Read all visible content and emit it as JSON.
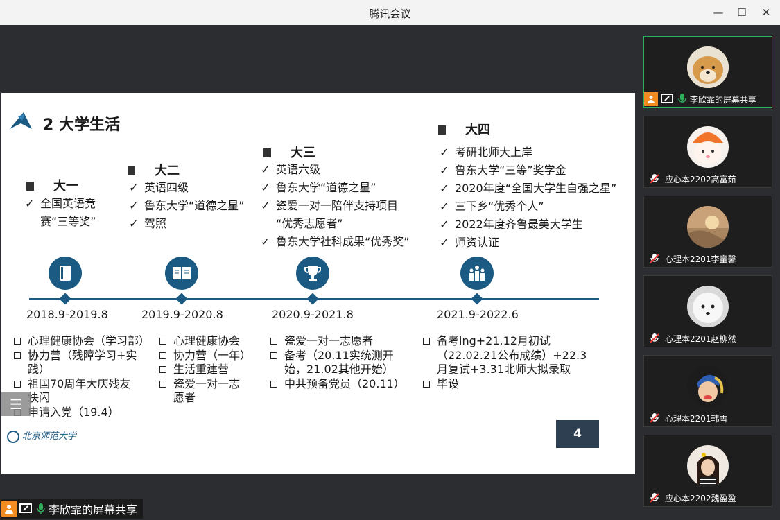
{
  "window": {
    "title": "腾讯会议",
    "minimize": "—",
    "maximize": "☐",
    "close": "✕"
  },
  "slide": {
    "title": "2 大学生活",
    "page_number": "4",
    "years": [
      {
        "head": "大一",
        "period": "2018.9-2019.8",
        "awards": [
          "全国英语竞",
          "赛“三等奖”"
        ],
        "activities": [
          "心理健康协会（学习部）",
          "协力营（残障学习+实",
          "践）",
          "祖国70周年大庆残友",
          "快闪",
          "申请入党（19.4）"
        ]
      },
      {
        "head": "大二",
        "period": "2019.9-2020.8",
        "awards": [
          "英语四级",
          "鲁东大学“道德之星”",
          "驾照"
        ],
        "activities": [
          "心理健康协会",
          "协力营（一年）",
          "生活重建营",
          "瓷爱一对一志",
          "愿者"
        ]
      },
      {
        "head": "大三",
        "period": "2020.9-2021.8",
        "awards": [
          "英语六级",
          "鲁东大学“道德之星”",
          "瓷爱一对一陪伴支持项目",
          "“优秀志愿者”",
          "鲁东大学社科成果“优秀奖”"
        ],
        "activities": [
          "瓷爱一对一志愿者",
          "备考（20.11实统测开",
          "始，21.02其他开始）",
          "中共预备党员（20.11）"
        ]
      },
      {
        "head": "大四",
        "period": "2021.9-2022.6",
        "awards": [
          "考研北师大上岸",
          "鲁东大学“三等”奖学金",
          "2020年度“全国大学生自强之星”",
          "三下乡“优秀个人”",
          "2022年度齐鲁最美大学生",
          "师资认证"
        ],
        "activities": [
          "备考ing+21.12月初试",
          "（22.02.21公布成绩）+22.3",
          "月复试+3.31北师大拟录取",
          "毕设"
        ]
      }
    ],
    "university_logo_text": "北京师范大学"
  },
  "share_bar": {
    "label": "李欣霏的屏幕共享"
  },
  "participants": [
    {
      "name": "李欣霏的屏幕共享",
      "avatar": "shiba-dog-avatar",
      "active": true
    },
    {
      "name": "应心本2202高富茹",
      "avatar": "cat-orange-hat-avatar",
      "active": false
    },
    {
      "name": "心理本2201李童馨",
      "avatar": "sunset-avatar",
      "active": false
    },
    {
      "name": "心理本2201赵柳然",
      "avatar": "white-dog-avatar",
      "active": false
    },
    {
      "name": "心理本2201韩雪",
      "avatar": "pearl-earring-avatar",
      "active": false
    },
    {
      "name": "应心本2202魏盈盈",
      "avatar": "girl-avatar",
      "active": false
    }
  ],
  "colors": {
    "accent": "#1a5a83",
    "active_border": "#2fae5b",
    "share_orange": "#f28b20"
  }
}
